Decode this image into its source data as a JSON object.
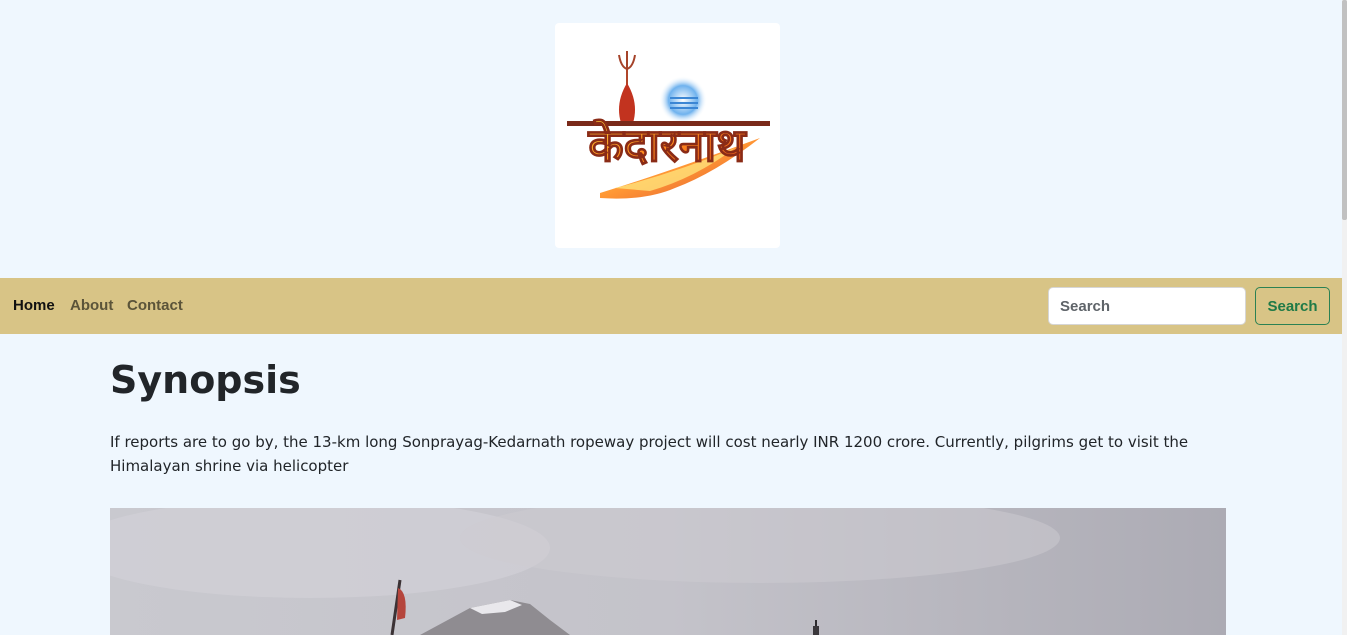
{
  "logo": {
    "alt_text": "केदारनाथ",
    "icon": "kedarnath-logo"
  },
  "navbar": {
    "items": [
      {
        "label": "Home",
        "active": true
      },
      {
        "label": "About",
        "active": false
      },
      {
        "label": "Contact",
        "active": false
      }
    ],
    "search": {
      "placeholder": "Search",
      "button_label": "Search"
    }
  },
  "main": {
    "title": "Synopsis",
    "paragraph": "If reports are to go by, the 13-km long Sonprayag-Kedarnath ropeway project will cost nearly INR 1200 crore. Currently, pilgrims get to visit the Himalayan shrine via helicopter"
  },
  "colors": {
    "page_background": "#eff7fe",
    "navbar_background": "#d8c486",
    "search_button_accent": "#1f7a47"
  }
}
